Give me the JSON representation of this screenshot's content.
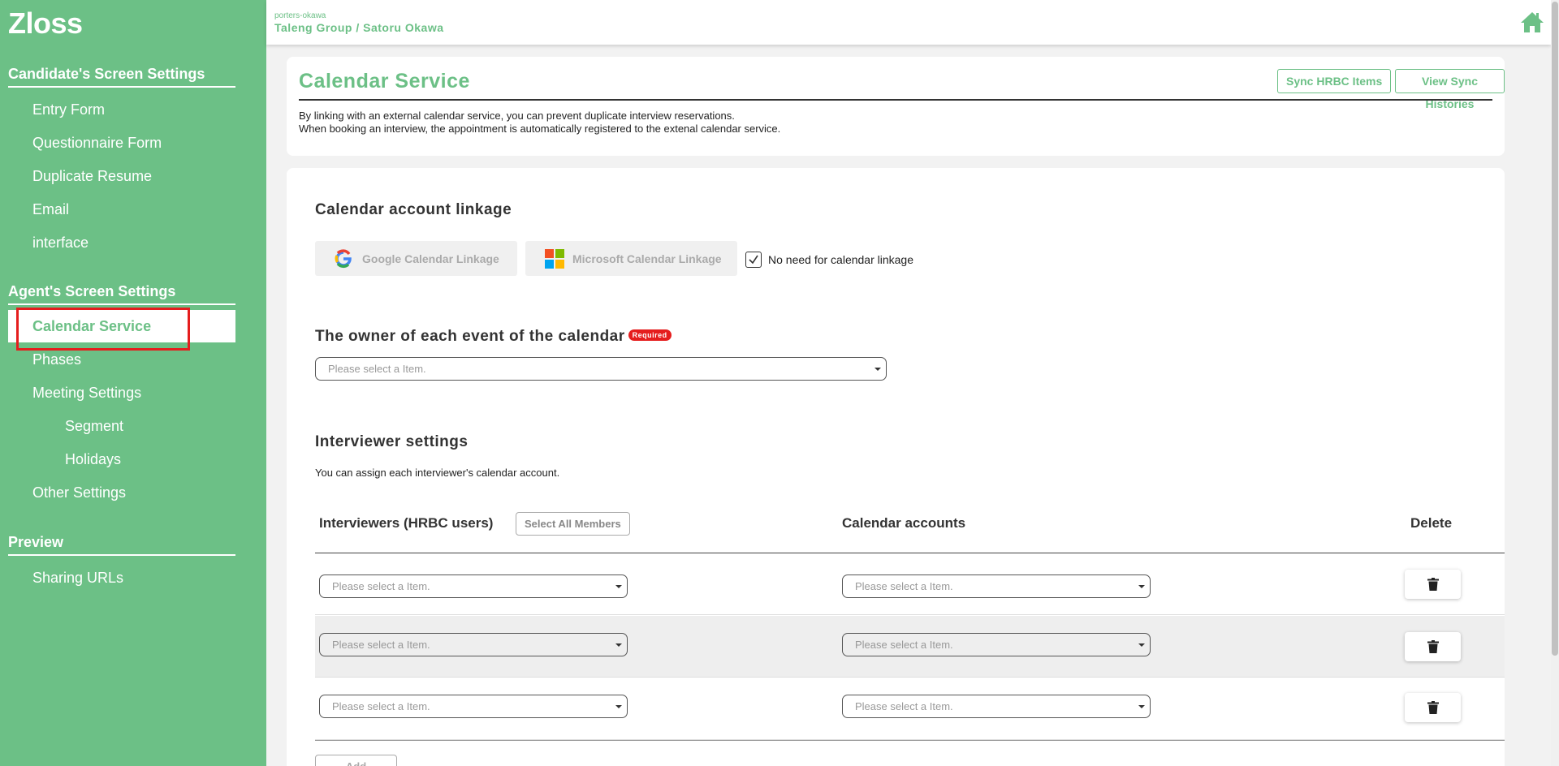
{
  "app": {
    "logo": "Zloss"
  },
  "account": {
    "id": "porters-okawa",
    "name": "Taleng Group / Satoru Okawa"
  },
  "sidebar": {
    "candidate_heading": "Candidate's Screen Settings",
    "candidate_items": [
      "Entry Form",
      "Questionnaire Form",
      "Duplicate Resume",
      "Email",
      "interface"
    ],
    "agent_heading": "Agent's Screen Settings",
    "agent_items": [
      "Calendar Service",
      "Phases",
      "Meeting Settings",
      "Segment",
      "Holidays",
      "Other Settings"
    ],
    "preview_heading": "Preview",
    "preview_items": [
      "Sharing URLs"
    ],
    "active_item": "Calendar Service"
  },
  "header": {
    "title": "Calendar Service",
    "sync_button": "Sync HRBC Items",
    "history_button": "View Sync Histories",
    "desc_line1": "By linking with an external calendar service, you can prevent duplicate interview reservations.",
    "desc_line2": "When booking an interview, the appointment is automatically registered to the extenal calendar service."
  },
  "linkage": {
    "heading": "Calendar account linkage",
    "google_button": "Google Calendar Linkage",
    "microsoft_button": "Microsoft Calendar Linkage",
    "no_need_label": "No need for calendar linkage",
    "no_need_checked": true
  },
  "owner": {
    "heading": "The owner of each event of the calendar",
    "required_badge": "Required",
    "placeholder": "Please select a Item."
  },
  "interviewers": {
    "heading": "Interviewer settings",
    "note": "You can assign each interviewer's calendar account.",
    "col_interviewers": "Interviewers (HRBC users)",
    "select_all": "Select All Members",
    "col_calendar": "Calendar accounts",
    "col_delete": "Delete",
    "rows": [
      {
        "interviewer": "Please select a Item.",
        "calendar": "Please select a Item."
      },
      {
        "interviewer": "Please select a Item.",
        "calendar": "Please select a Item."
      },
      {
        "interviewer": "Please select a Item.",
        "calendar": "Please select a Item."
      }
    ],
    "add_button": "Add"
  },
  "colors": {
    "brand": "#6cc086",
    "highlight": "#e51d1d",
    "badge": "#e51d1d"
  },
  "icons": {
    "home": "home-icon",
    "delete": "trash-icon",
    "google": "google-icon",
    "microsoft": "microsoft-icon",
    "check": "check-icon",
    "caret": "caret-down-icon"
  }
}
